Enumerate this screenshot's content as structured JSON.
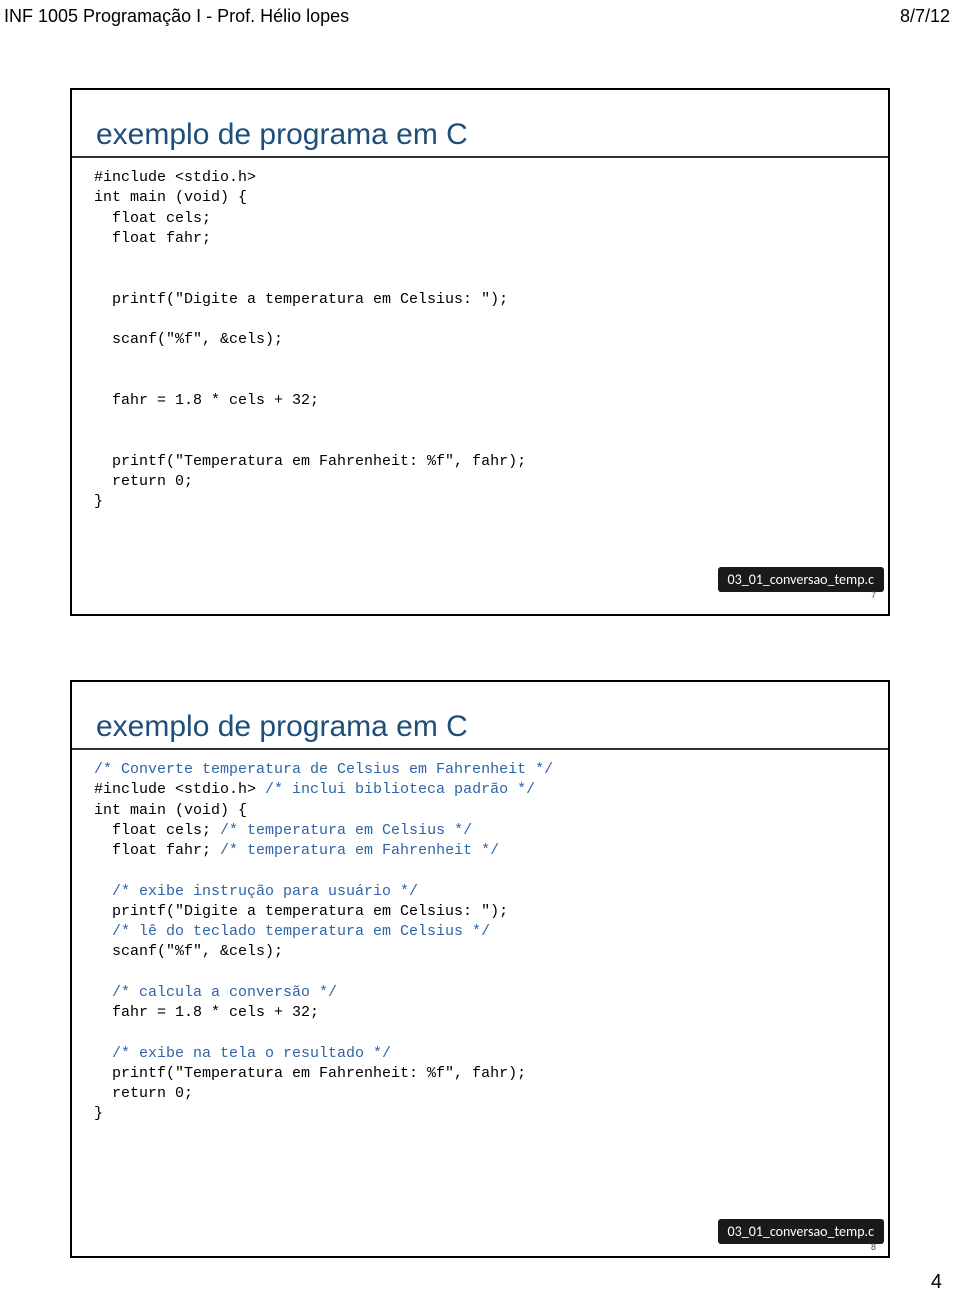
{
  "header": {
    "left": "INF 1005 Programação I - Prof. Hélio lopes",
    "right": "8/7/12"
  },
  "page_number": "4",
  "slide1": {
    "title": "exemplo de programa em C",
    "code_lines": [
      {
        "t": "#include <stdio.h>"
      },
      {
        "t": "int main (void) {"
      },
      {
        "t": "  float cels;"
      },
      {
        "t": "  float fahr;"
      },
      {
        "t": ""
      },
      {
        "t": ""
      },
      {
        "t": "  printf(\"Digite a temperatura em Celsius: \");"
      },
      {
        "t": ""
      },
      {
        "t": "  scanf(\"%f\", &cels);"
      },
      {
        "t": ""
      },
      {
        "t": ""
      },
      {
        "t": "  fahr = 1.8 * cels + 32;"
      },
      {
        "t": ""
      },
      {
        "t": ""
      },
      {
        "t": "  printf(\"Temperatura em Fahrenheit: %f\", fahr);"
      },
      {
        "t": "  return 0;"
      },
      {
        "t": "}"
      }
    ],
    "badge": "03_01_conversao_temp.c",
    "small_num": "7"
  },
  "slide2": {
    "title": "exemplo de programa em C",
    "code_lines": [
      {
        "t": "/* Converte temperatura de Celsius em Fahrenheit */",
        "c": true
      },
      {
        "segments": [
          {
            "t": "#include <stdio.h> "
          },
          {
            "t": "/* inclui biblioteca padrão */",
            "c": true
          }
        ]
      },
      {
        "t": "int main (void) {"
      },
      {
        "segments": [
          {
            "t": "  float cels; "
          },
          {
            "t": "/* temperatura em Celsius */",
            "c": true
          }
        ]
      },
      {
        "segments": [
          {
            "t": "  float fahr; "
          },
          {
            "t": "/* temperatura em Fahrenheit */",
            "c": true
          }
        ]
      },
      {
        "t": ""
      },
      {
        "t": "  /* exibe instrução para usuário */",
        "c": true,
        "indent": true
      },
      {
        "t": "  printf(\"Digite a temperatura em Celsius: \");"
      },
      {
        "t": "  /* lê do teclado temperatura em Celsius */",
        "c": true,
        "indent": true
      },
      {
        "t": "  scanf(\"%f\", &cels);"
      },
      {
        "t": ""
      },
      {
        "t": "  /* calcula a conversão */",
        "c": true,
        "indent": true
      },
      {
        "t": "  fahr = 1.8 * cels + 32;"
      },
      {
        "t": ""
      },
      {
        "t": "  /* exibe na tela o resultado */",
        "c": true,
        "indent": true
      },
      {
        "t": "  printf(\"Temperatura em Fahrenheit: %f\", fahr);"
      },
      {
        "t": "  return 0;"
      },
      {
        "t": "}"
      }
    ],
    "badge": "03_01_conversao_temp.c",
    "small_num": "8"
  }
}
